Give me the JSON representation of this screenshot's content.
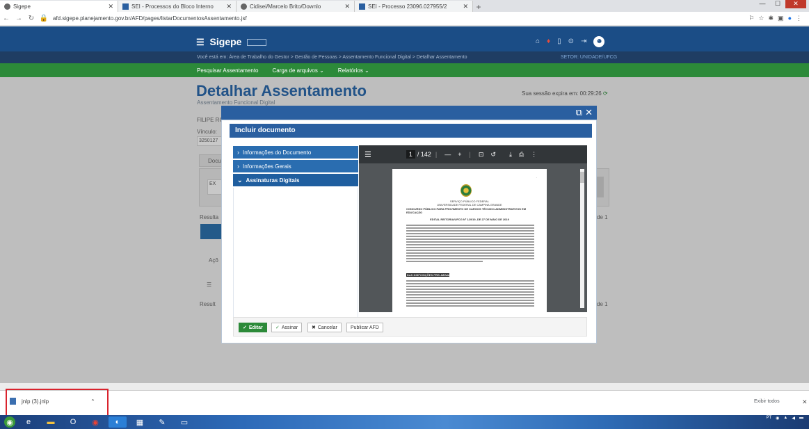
{
  "browser": {
    "tabs": [
      {
        "title": "Sigepe",
        "active": true
      },
      {
        "title": "SEI - Processos do Bloco Interno",
        "active": false
      },
      {
        "title": "Cidisei/Marcelo Brito/Downlo",
        "active": false
      },
      {
        "title": "SEI - Processo 23096.027955/2",
        "active": false
      }
    ],
    "new_tab": "+",
    "url": "afd.sigepe.planejamento.gov.br/AFD/pages/listarDocumentosAssentamento.jsf"
  },
  "header": {
    "logo": "Sigepe",
    "breadcrumb": "Você está em: Área de Trabalho do Gestor > Gestão de Pessoas > Assentamento Funcional Digital > Detalhar Assentamento",
    "sector": "SETOR: UNIDADE/UFCG"
  },
  "menu": {
    "items": [
      "Pesquisar Assentamento",
      "Carga de arquivos ⌄",
      "Relatórios ⌄"
    ]
  },
  "page": {
    "title": "Detalhar Assentamento",
    "subtitle": "Assentamento Funcional Digital",
    "session": "Sua sessão expira em: 00:29:26",
    "name_label": "FILIPE RO",
    "vinculo_label": "Vínculo:",
    "vinculo_value": "3250127",
    "tab_label": "Docu",
    "filter_placeholder": "EX",
    "results_label": "Resulta",
    "actions_label": "Açõ",
    "results_label2": "Result",
    "page_right": "de 1"
  },
  "modal": {
    "title": "Incluir documento",
    "sections": [
      {
        "label": "Informações do Documento",
        "open": false
      },
      {
        "label": "Informações Gerais",
        "open": false
      },
      {
        "label": "Assinaturas Digitais",
        "open": true
      }
    ],
    "buttons": {
      "edit": "Editar",
      "sign": "Assinar",
      "cancel": "Cancelar",
      "publish": "Publicar AFD"
    }
  },
  "pdf": {
    "page_current": "1",
    "page_total": "/ 142",
    "doc_header": [
      "SERVIÇO PÚBLICO FEDERAL",
      "UNIVERSIDADE FEDERAL DE CAMPINA GRANDE"
    ],
    "doc_concurso": "CONCURSO PÚBLICO PARA PROVIMENTO DE CARGOS TÉCNICO-ADMINISTRATIVOS EM EDUCAÇÃO",
    "doc_edital": "EDITAL REITORIA/UFCG Nº 1/2019, DE 27 DE MAIO DE 2019",
    "doc_section": "DAS DISPOSIÇÕES PRELIMINARES"
  },
  "download_bar": {
    "file_name": "jnlp (3).jnlp",
    "show_all": "Exibir todos",
    "close": "✕"
  },
  "colors": {
    "header_blue": "#1b4d86",
    "menu_green": "#2c8a39",
    "title_blue": "#2a66a6",
    "modal_blue": "#2a5fa0",
    "highlight_red": "#d9232d"
  }
}
